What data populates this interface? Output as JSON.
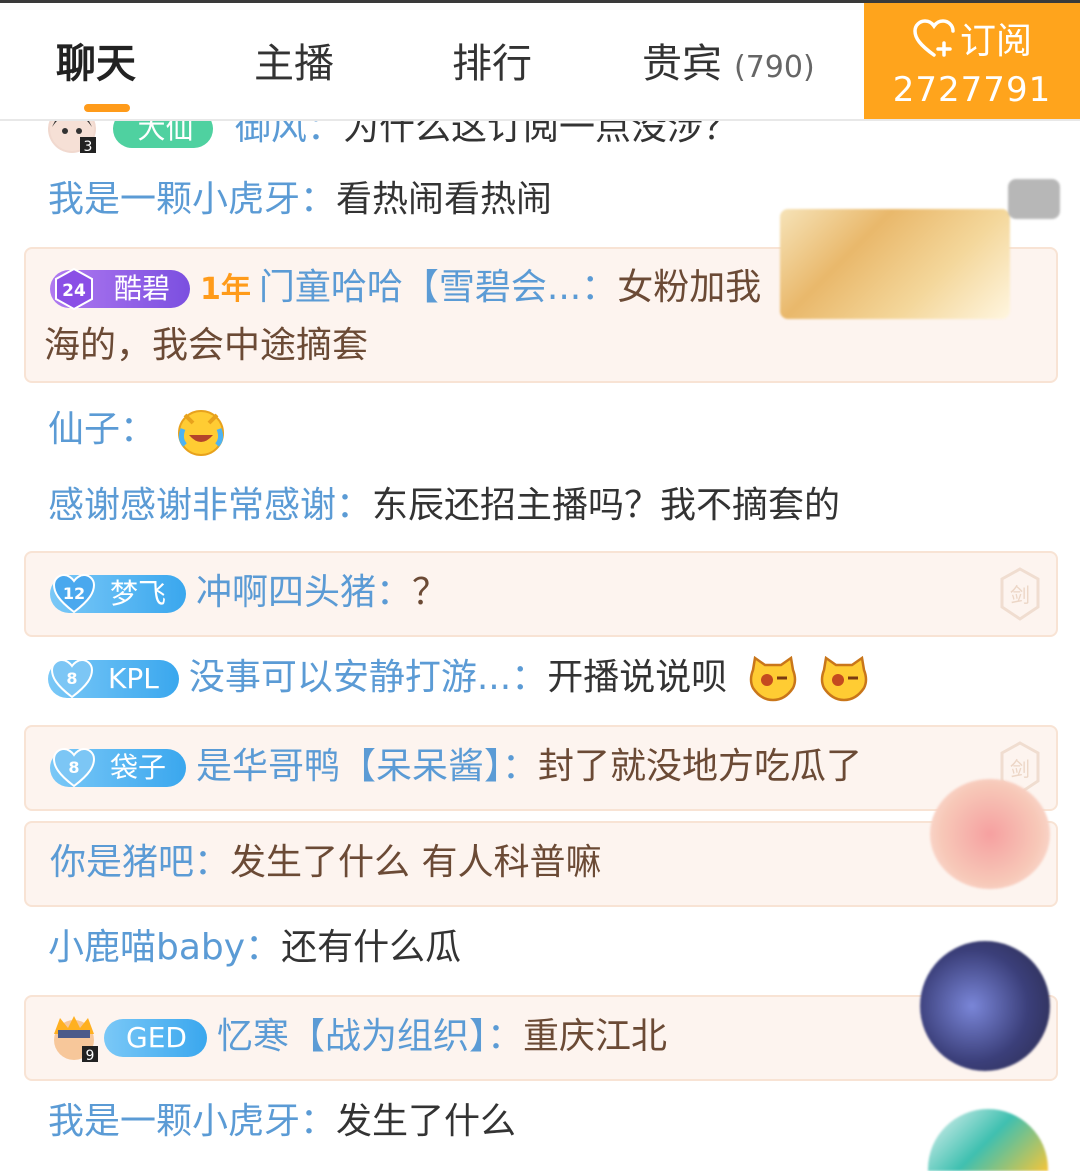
{
  "tabs": [
    {
      "label": "聊天",
      "active": true
    },
    {
      "label": "主播",
      "active": false
    },
    {
      "label": "排行",
      "active": false
    },
    {
      "label": "贵宾",
      "active": false,
      "count": "(790)"
    }
  ],
  "subscribe": {
    "label": "订阅",
    "count": "2727791"
  },
  "messages": [
    {
      "name": "御风",
      "text": "为什么这订阅一点没涉？",
      "badge": "大仙",
      "avatar_level": "3"
    },
    {
      "name": "我是一颗小虎牙",
      "text": "看热闹看热闹"
    },
    {
      "name": "门童哈哈【雪碧会...",
      "text": "女粉加我",
      "text2": "海的，我会中途摘套",
      "badge": "酷碧",
      "badge_level": "24",
      "year_mark": "1年"
    },
    {
      "name": "仙子",
      "text": "",
      "emoji": "laugh-cry"
    },
    {
      "name": "感谢感谢非常感谢",
      "text": "东辰还招主播吗？我不摘套的"
    },
    {
      "name": "冲啊四头猪",
      "text": "？",
      "badge": "梦飞",
      "badge_level": "12",
      "corner": "剑"
    },
    {
      "name": "没事可以安静打游...",
      "text": "开播说说呗",
      "badge": "KPL",
      "badge_level": "8"
    },
    {
      "name": "是华哥鸭【呆呆酱】",
      "text": "封了就没地方吃瓜了",
      "badge": "袋子",
      "badge_level": "8",
      "corner": "剑"
    },
    {
      "name": "你是猪吧",
      "text": "发生了什么 有人科普嘛"
    },
    {
      "name": "小鹿喵baby",
      "text": "还有什么瓜"
    },
    {
      "name": "忆寒【战为组织】",
      "text": "重庆江北",
      "badge": "GED",
      "avatar_level": "9"
    },
    {
      "name": "我是一颗小虎牙",
      "text": "发生了什么"
    }
  ],
  "separator": "：",
  "colors": {
    "accent": "#ffa41c",
    "name": "#5b9bd5",
    "highlight_bg": "#fdf4ef"
  }
}
